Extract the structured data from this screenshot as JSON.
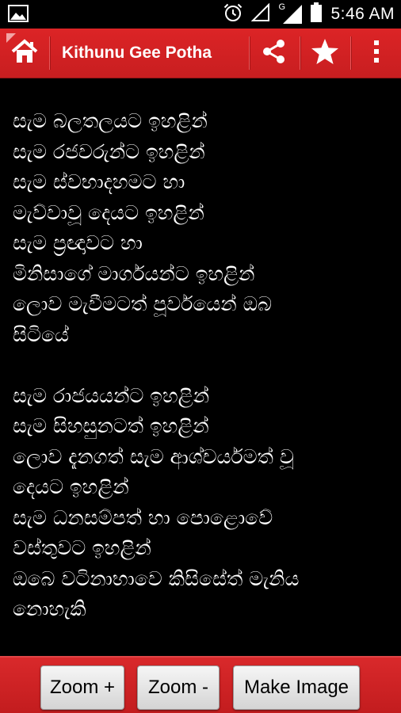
{
  "status_bar": {
    "time": "5:46 AM",
    "signal_label": "G",
    "icons": [
      "gallery-icon",
      "alarm-icon",
      "wifi-icon",
      "signal-icon",
      "battery-icon"
    ]
  },
  "action_bar": {
    "title": "Kithunu Gee Potha",
    "icons": [
      "home-icon",
      "share-icon",
      "star-icon",
      "overflow-menu-icon"
    ],
    "color": "#d32124"
  },
  "lyrics": {
    "stanzas": [
      [
        "සැම බලතලයට ඉහළින්",
        "සැම රජවරුන්ට ඉහළින්",
        "සැම ස්වභාදහමට හා",
        "මැව්වාවූ දෙයට ඉහළින්",
        "සැම ප්‍රඥාවට හා",
        "මිනිසාගේ මාර්ගයන්ට ඉහළින්",
        "ලොව මැවීමටත් පූර්වයෙන් ඔබ",
        "සිටියේ"
      ],
      [
        "සැම රාජයයන්ට ඉහළින්",
        "සැම සිහසුනටත් ඉහළින්",
        "ලොව දැනගත් සැම ආශ්චර්යමත් වූ",
        "දෙයට ඉහළින්",
        "සැම ධනසම්පත් හා පොළොවේ",
        "වස්තුවට ඉහළින්",
        "ඔබෙ වටිනාභාවෙ කිසිසේත් මැනිය",
        "නොහැකි"
      ]
    ]
  },
  "bottom_bar": {
    "zoom_in_label": "Zoom +",
    "zoom_out_label": "Zoom -",
    "make_image_label": "Make Image"
  }
}
